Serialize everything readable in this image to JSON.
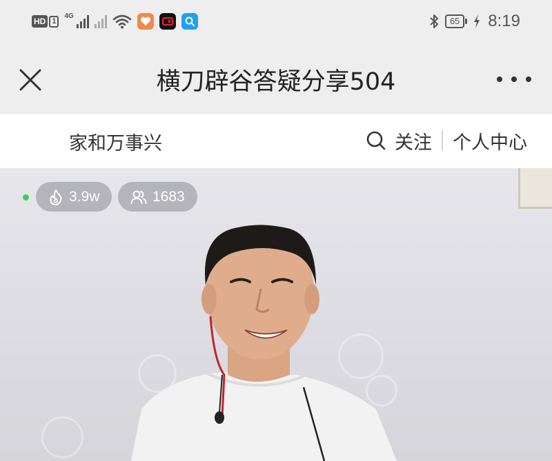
{
  "status_bar": {
    "hd_label": "HD",
    "sim_label": "1",
    "network_label": "4G",
    "time": "8:19",
    "battery_level": "65",
    "icons": [
      "signal-bars-icon",
      "no-signal-icon",
      "wifi-icon",
      "health-app-icon",
      "video-app-icon",
      "search-app-icon",
      "bluetooth-icon",
      "charging-icon"
    ]
  },
  "nav": {
    "title": "横刀辟谷答疑分享504",
    "close_icon": "close-icon",
    "more_icon": "more-icon"
  },
  "info_bar": {
    "channel_name": "家和万事兴",
    "follow_label": "关注",
    "personal_center_label": "个人中心"
  },
  "video": {
    "heat": "3.9w",
    "viewers": "1683",
    "live_dot_color": "#3fcf5c"
  }
}
